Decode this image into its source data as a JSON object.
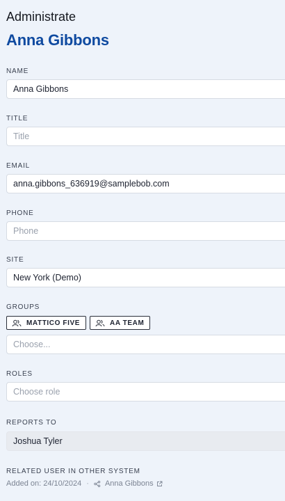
{
  "header": {
    "title": "Administrate",
    "user_name": "Anna Gibbons"
  },
  "fields": {
    "name": {
      "label": "NAME",
      "value": "Anna Gibbons",
      "placeholder": ""
    },
    "title": {
      "label": "TITLE",
      "value": "",
      "placeholder": "Title"
    },
    "email": {
      "label": "EMAIL",
      "value": "anna.gibbons_636919@samplebob.com",
      "placeholder": ""
    },
    "phone": {
      "label": "PHONE",
      "value": "",
      "placeholder": "Phone"
    },
    "site": {
      "label": "SITE",
      "value": "New York (Demo)",
      "placeholder": ""
    },
    "groups": {
      "label": "GROUPS",
      "chips": [
        "MATTICO FIVE",
        "AA TEAM"
      ],
      "placeholder": "Choose..."
    },
    "roles": {
      "label": "ROLES",
      "placeholder": "Choose role"
    },
    "reports_to": {
      "label": "REPORTS TO",
      "value": "Joshua Tyler"
    }
  },
  "related": {
    "label": "RELATED USER IN OTHER SYSTEM",
    "added_on": "Added on: 24/10/2024",
    "separator": "·",
    "user": "Anna Gibbons"
  },
  "icons": {
    "group_chip": "users-icon",
    "related_link": "link-icon",
    "external": "external-link-icon"
  },
  "colors": {
    "accent": "#0f4aa0",
    "background": "#eef3fa"
  }
}
